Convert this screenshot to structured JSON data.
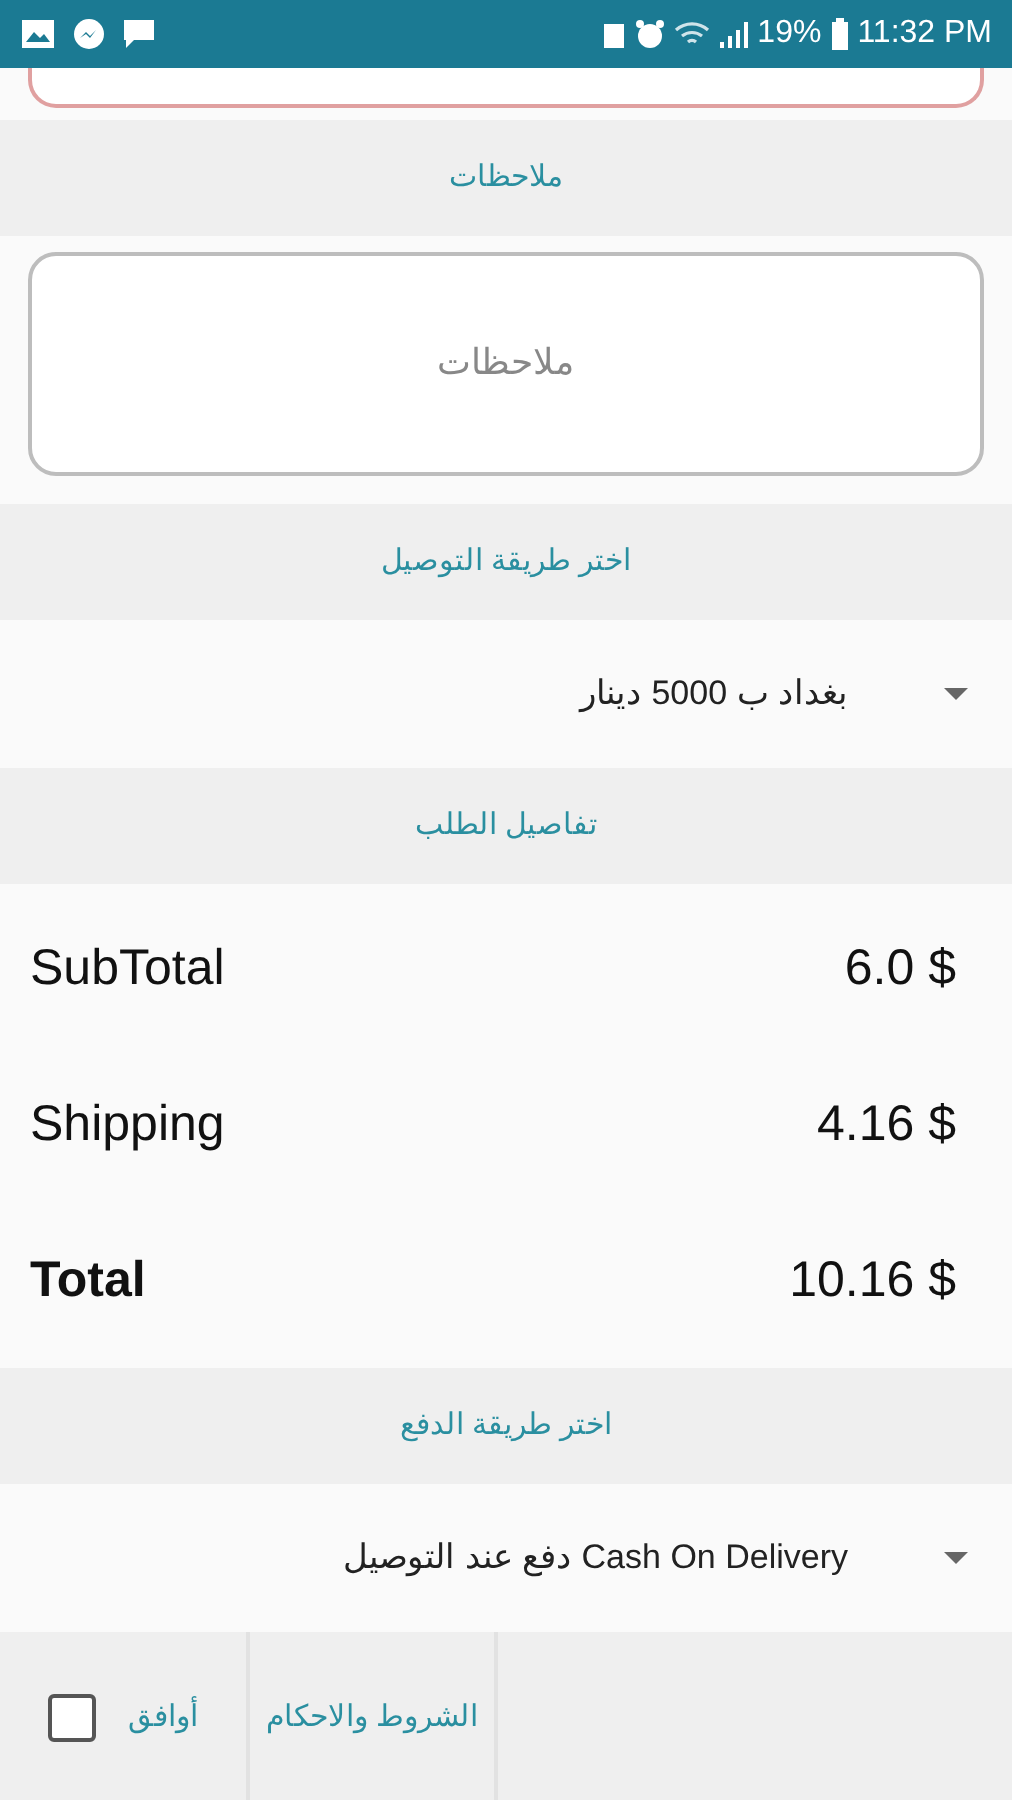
{
  "status_bar": {
    "battery": "19%",
    "time": "11:32 PM"
  },
  "sections": [
    {
      "kind": "header",
      "title": "ملاحظات"
    },
    {
      "kind": "textarea",
      "placeholder": "ملاحظات"
    },
    {
      "kind": "header",
      "title": "اختر طريقة التوصيل"
    },
    {
      "kind": "dropdown",
      "value": "بغداد ب 5000 دينار"
    },
    {
      "kind": "header",
      "title": "تفاصيل الطلب"
    },
    {
      "kind": "totals",
      "rows": [
        {
          "label": "SubTotal",
          "value": "6.0 $",
          "bold": false
        },
        {
          "label": "Shipping",
          "value": "4.16 $",
          "bold": false
        },
        {
          "label": "Total",
          "value": "10.16 $",
          "bold": true
        }
      ]
    },
    {
      "kind": "header",
      "title": "اختر طريقة الدفع"
    },
    {
      "kind": "dropdown",
      "value": "Cash On Delivery دفع عند التوصيل"
    }
  ],
  "footer": {
    "agree_label": "أوافق",
    "checked": false,
    "terms_link": "الشروط والاحكام"
  }
}
